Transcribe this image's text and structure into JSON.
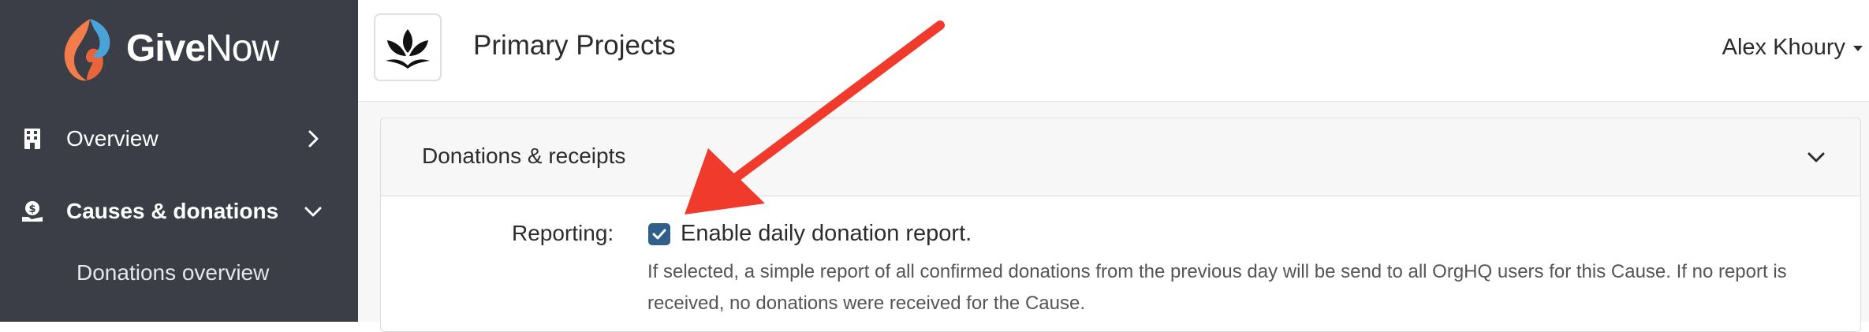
{
  "brand": {
    "name_bold": "Give",
    "name_regular": "Now"
  },
  "sidebar": {
    "items": [
      {
        "label": "Overview",
        "icon": "building-icon",
        "expanded": false
      },
      {
        "label": "Causes & donations",
        "icon": "donation-hand-icon",
        "expanded": true
      }
    ],
    "sub_items": [
      {
        "label": "Donations overview"
      }
    ]
  },
  "header": {
    "org_logo_icon": "lotus-icon",
    "title": "Primary Projects",
    "user_name": "Alex Khoury"
  },
  "panel": {
    "title": "Donations & receipts",
    "field_label": "Reporting:",
    "checkbox_label": "Enable daily donation report.",
    "checkbox_checked": true,
    "help_text": "If selected, a simple report of all confirmed donations from the previous day will be send to all OrgHQ users for this Cause. If no report is received, no donations were received for the Cause."
  },
  "colors": {
    "sidebar_bg": "#3b3e47",
    "accent": "#2f5f8a",
    "annotation_arrow": "#f03a2c",
    "logo_orange": "#f27c4a",
    "logo_blue": "#4aa3d8"
  }
}
